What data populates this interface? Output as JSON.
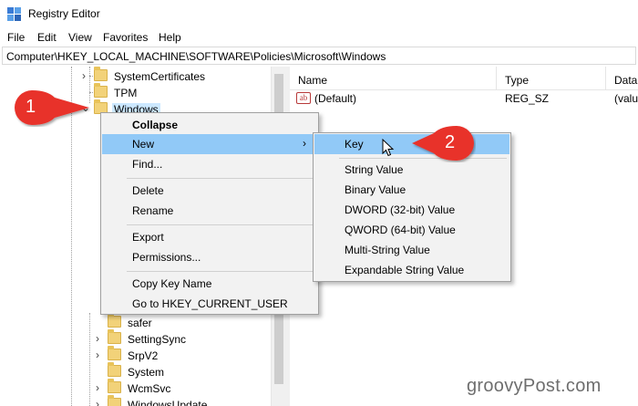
{
  "window": {
    "title": "Registry Editor"
  },
  "menubar": {
    "items": [
      "File",
      "Edit",
      "View",
      "Favorites",
      "Help"
    ]
  },
  "address": {
    "path": "Computer\\HKEY_LOCAL_MACHINE\\SOFTWARE\\Policies\\Microsoft\\Windows"
  },
  "tree": {
    "top_items": [
      "SystemCertificates",
      "TPM",
      "Windows"
    ],
    "bottom_items": [
      "safer",
      "SettingSync",
      "SrpV2",
      "System",
      "WcmSvc",
      "WindowsUpdate"
    ]
  },
  "list": {
    "columns": [
      "Name",
      "Type",
      "Data"
    ],
    "rows": [
      {
        "name": "(Default)",
        "type": "REG_SZ",
        "data": "(valu"
      }
    ]
  },
  "context_menu": {
    "collapse": "Collapse",
    "new": "New",
    "find": "Find...",
    "delete": "Delete",
    "rename": "Rename",
    "export": "Export",
    "permissions": "Permissions...",
    "copy_key_name": "Copy Key Name",
    "goto_hkcu": "Go to HKEY_CURRENT_USER"
  },
  "submenu": {
    "items": [
      "Key",
      "String Value",
      "Binary Value",
      "DWORD (32-bit) Value",
      "QWORD (64-bit) Value",
      "Multi-String Value",
      "Expandable String Value"
    ]
  },
  "callouts": {
    "one": "1",
    "two": "2"
  },
  "watermark": "groovyPost.com",
  "colors": {
    "highlight": "#91c9f7",
    "selection": "#cce8ff",
    "callout_red": "#e8312b",
    "folder": "#f2d279"
  }
}
